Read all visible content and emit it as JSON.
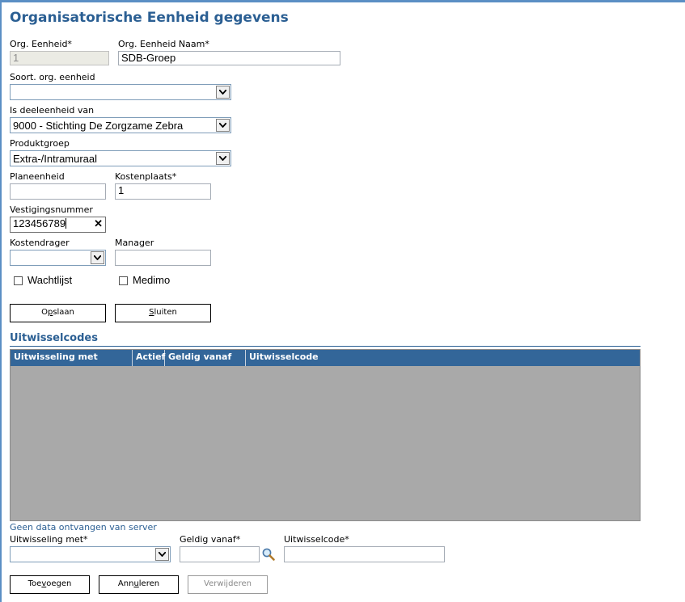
{
  "page": {
    "title": "Organisatorische Eenheid gegevens"
  },
  "form": {
    "org_eenheid": {
      "label": "Org. Eenheid*",
      "value": "1"
    },
    "org_eenheid_naam": {
      "label": "Org. Eenheid Naam*",
      "value": "SDB-Groep"
    },
    "soort_org_eenheid": {
      "label": "Soort. org. eenheid",
      "value": ""
    },
    "is_deeleenheid_van": {
      "label": "Is deeleenheid van",
      "value": "9000 - Stichting De Zorgzame Zebra"
    },
    "produktgroep": {
      "label": "Produktgroep",
      "value": "Extra-/Intramuraal"
    },
    "planeenheid": {
      "label": "Planeenheid",
      "value": ""
    },
    "kostenplaats": {
      "label": "Kostenplaats*",
      "value": "1"
    },
    "vestigingsnummer": {
      "label": "Vestigingsnummer",
      "value": "123456789"
    },
    "kostendrager": {
      "label": "Kostendrager",
      "value": ""
    },
    "manager": {
      "label": "Manager",
      "value": ""
    },
    "wachtlijst": {
      "label": "Wachtlijst",
      "checked": false
    },
    "medimo": {
      "label": "Medimo",
      "checked": false
    }
  },
  "buttons": {
    "opslaan": {
      "label_pre": "O",
      "label_ul": "p",
      "label_post": "slaan"
    },
    "sluiten": {
      "label_pre": "",
      "label_ul": "S",
      "label_post": "luiten"
    },
    "toevoegen": {
      "label_pre": "Toe",
      "label_ul": "v",
      "label_post": "oegen"
    },
    "annuleren": {
      "label_pre": "Ann",
      "label_ul": "u",
      "label_post": "leren"
    },
    "verwijderen": {
      "label": "Verwijderen"
    }
  },
  "uitwisselcodes": {
    "section_title": "Uitwisselcodes",
    "columns": [
      "Uitwisseling met",
      "Actief",
      "Geldig vanaf",
      "Uitwisselcode"
    ],
    "rows": [],
    "status": "Geen data ontvangen van server"
  },
  "uitwissel_form": {
    "uitwisseling_met": {
      "label": "Uitwisseling met*",
      "value": ""
    },
    "geldig_vanaf": {
      "label": "Geldig vanaf*",
      "value": ""
    },
    "uitwisselcode": {
      "label": "Uitwisselcode*",
      "value": ""
    }
  },
  "icons": {
    "dropdown": "chevron-down-icon",
    "clear": "close-icon",
    "date_lookup": "magnifier-icon"
  },
  "colors": {
    "title": "#2b5f93",
    "grid_header": "#336699",
    "grid_body": "#a9a9a9",
    "accent_bar": "#5b8fc4"
  }
}
